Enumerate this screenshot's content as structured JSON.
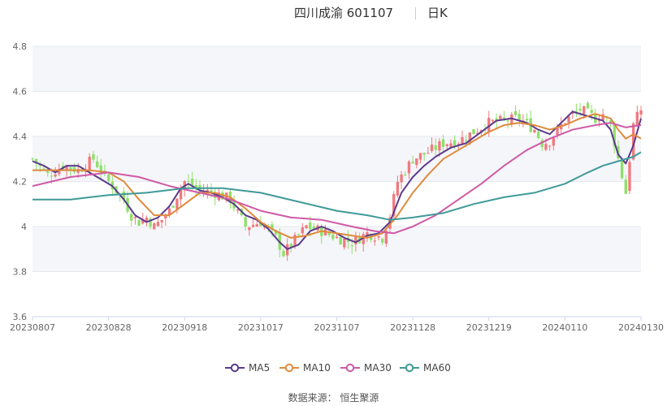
{
  "title": {
    "name": "四川成渝 601107",
    "period": "日K"
  },
  "legend": [
    {
      "name": "MA5",
      "color": "#5b3a8c"
    },
    {
      "name": "MA10",
      "color": "#e08a3c"
    },
    {
      "name": "MA30",
      "color": "#cf5aa6"
    },
    {
      "name": "MA60",
      "color": "#3f9a98"
    }
  ],
  "source": "数据来源： 恒生聚源",
  "colors": {
    "up": "#f07a7f",
    "down": "#8fe06a",
    "plot_band": "#f5f6fa",
    "grid": "#e6e8ef"
  },
  "chart_data": {
    "type": "candlestick",
    "ylim": [
      3.6,
      4.8
    ],
    "yticks": [
      "3.6",
      "3.8",
      "4",
      "4.2",
      "4.4",
      "4.6",
      "4.8"
    ],
    "xticks": [
      "20230807",
      "20230828",
      "20230918",
      "20231017",
      "20231107",
      "20231128",
      "20231219",
      "20240110",
      "20240130"
    ],
    "xtick_index": [
      0,
      20,
      40,
      60,
      80,
      100,
      120,
      140,
      160
    ],
    "n_candles": 161,
    "close_anchors": [
      [
        0,
        4.3
      ],
      [
        4,
        4.23
      ],
      [
        8,
        4.27
      ],
      [
        12,
        4.25
      ],
      [
        16,
        4.3
      ],
      [
        20,
        4.2
      ],
      [
        24,
        4.12
      ],
      [
        26,
        4.05
      ],
      [
        28,
        4.02
      ],
      [
        30,
        4.04
      ],
      [
        32,
        4.0
      ],
      [
        34,
        4.03
      ],
      [
        36,
        4.07
      ],
      [
        38,
        4.14
      ],
      [
        40,
        4.2
      ],
      [
        42,
        4.18
      ],
      [
        44,
        4.16
      ],
      [
        48,
        4.15
      ],
      [
        52,
        4.12
      ],
      [
        56,
        4.0
      ],
      [
        60,
        4.02
      ],
      [
        64,
        3.95
      ],
      [
        66,
        3.88
      ],
      [
        68,
        3.92
      ],
      [
        72,
        4.0
      ],
      [
        76,
        3.98
      ],
      [
        80,
        3.95
      ],
      [
        84,
        3.93
      ],
      [
        88,
        3.97
      ],
      [
        92,
        3.95
      ],
      [
        94,
        4.05
      ],
      [
        96,
        4.2
      ],
      [
        98,
        4.25
      ],
      [
        100,
        4.3
      ],
      [
        104,
        4.33
      ],
      [
        108,
        4.37
      ],
      [
        112,
        4.38
      ],
      [
        116,
        4.42
      ],
      [
        120,
        4.46
      ],
      [
        124,
        4.47
      ],
      [
        128,
        4.48
      ],
      [
        132,
        4.43
      ],
      [
        134,
        4.37
      ],
      [
        136,
        4.38
      ],
      [
        140,
        4.47
      ],
      [
        144,
        4.52
      ],
      [
        148,
        4.48
      ],
      [
        150,
        4.5
      ],
      [
        152,
        4.45
      ],
      [
        154,
        4.3
      ],
      [
        156,
        4.15
      ],
      [
        158,
        4.45
      ],
      [
        160,
        4.52
      ]
    ],
    "series": [
      {
        "name": "MA5",
        "color": "#5b3a8c",
        "points": [
          [
            0,
            4.29
          ],
          [
            3,
            4.27
          ],
          [
            6,
            4.24
          ],
          [
            9,
            4.27
          ],
          [
            12,
            4.27
          ],
          [
            14,
            4.25
          ],
          [
            17,
            4.22
          ],
          [
            19,
            4.2
          ],
          [
            21,
            4.18
          ],
          [
            24,
            4.12
          ],
          [
            27,
            4.05
          ],
          [
            30,
            4.02
          ],
          [
            33,
            4.04
          ],
          [
            36,
            4.09
          ],
          [
            39,
            4.17
          ],
          [
            41,
            4.19
          ],
          [
            44,
            4.16
          ],
          [
            47,
            4.15
          ],
          [
            50,
            4.13
          ],
          [
            53,
            4.1
          ],
          [
            56,
            4.05
          ],
          [
            59,
            4.03
          ],
          [
            62,
            3.99
          ],
          [
            65,
            3.93
          ],
          [
            67,
            3.9
          ],
          [
            70,
            3.92
          ],
          [
            73,
            3.98
          ],
          [
            76,
            4.0
          ],
          [
            79,
            3.98
          ],
          [
            82,
            3.95
          ],
          [
            85,
            3.93
          ],
          [
            88,
            3.96
          ],
          [
            91,
            3.97
          ],
          [
            94,
            4.02
          ],
          [
            97,
            4.15
          ],
          [
            100,
            4.22
          ],
          [
            103,
            4.27
          ],
          [
            106,
            4.31
          ],
          [
            110,
            4.35
          ],
          [
            114,
            4.37
          ],
          [
            118,
            4.42
          ],
          [
            122,
            4.47
          ],
          [
            126,
            4.48
          ],
          [
            130,
            4.46
          ],
          [
            133,
            4.43
          ],
          [
            136,
            4.41
          ],
          [
            139,
            4.46
          ],
          [
            142,
            4.51
          ],
          [
            146,
            4.49
          ],
          [
            150,
            4.47
          ],
          [
            152,
            4.43
          ],
          [
            154,
            4.32
          ],
          [
            156,
            4.28
          ],
          [
            158,
            4.36
          ],
          [
            160,
            4.48
          ]
        ]
      },
      {
        "name": "MA10",
        "color": "#e08a3c",
        "points": [
          [
            0,
            4.25
          ],
          [
            5,
            4.25
          ],
          [
            10,
            4.25
          ],
          [
            15,
            4.25
          ],
          [
            20,
            4.24
          ],
          [
            24,
            4.2
          ],
          [
            28,
            4.12
          ],
          [
            32,
            4.05
          ],
          [
            36,
            4.05
          ],
          [
            40,
            4.1
          ],
          [
            44,
            4.15
          ],
          [
            48,
            4.15
          ],
          [
            52,
            4.13
          ],
          [
            56,
            4.08
          ],
          [
            60,
            4.02
          ],
          [
            64,
            3.98
          ],
          [
            68,
            3.95
          ],
          [
            72,
            3.96
          ],
          [
            76,
            3.98
          ],
          [
            80,
            3.97
          ],
          [
            84,
            3.96
          ],
          [
            88,
            3.95
          ],
          [
            92,
            3.97
          ],
          [
            96,
            4.05
          ],
          [
            100,
            4.15
          ],
          [
            104,
            4.23
          ],
          [
            108,
            4.3
          ],
          [
            112,
            4.34
          ],
          [
            116,
            4.38
          ],
          [
            120,
            4.42
          ],
          [
            124,
            4.45
          ],
          [
            128,
            4.46
          ],
          [
            132,
            4.45
          ],
          [
            136,
            4.43
          ],
          [
            140,
            4.45
          ],
          [
            144,
            4.48
          ],
          [
            148,
            4.5
          ],
          [
            152,
            4.48
          ],
          [
            154,
            4.43
          ],
          [
            156,
            4.39
          ],
          [
            158,
            4.41
          ],
          [
            160,
            4.39
          ]
        ]
      },
      {
        "name": "MA30",
        "color": "#cf5aa6",
        "points": [
          [
            0,
            4.18
          ],
          [
            10,
            4.22
          ],
          [
            20,
            4.24
          ],
          [
            28,
            4.22
          ],
          [
            36,
            4.18
          ],
          [
            44,
            4.15
          ],
          [
            52,
            4.12
          ],
          [
            60,
            4.07
          ],
          [
            68,
            4.04
          ],
          [
            76,
            4.03
          ],
          [
            84,
            4.0
          ],
          [
            90,
            3.98
          ],
          [
            95,
            3.97
          ],
          [
            100,
            4.0
          ],
          [
            106,
            4.05
          ],
          [
            112,
            4.12
          ],
          [
            118,
            4.19
          ],
          [
            124,
            4.27
          ],
          [
            130,
            4.34
          ],
          [
            136,
            4.39
          ],
          [
            142,
            4.43
          ],
          [
            148,
            4.45
          ],
          [
            152,
            4.46
          ],
          [
            156,
            4.44
          ],
          [
            160,
            4.45
          ]
        ]
      },
      {
        "name": "MA60",
        "color": "#3f9a98",
        "points": [
          [
            0,
            4.12
          ],
          [
            10,
            4.12
          ],
          [
            20,
            4.14
          ],
          [
            30,
            4.15
          ],
          [
            40,
            4.17
          ],
          [
            50,
            4.17
          ],
          [
            60,
            4.15
          ],
          [
            70,
            4.11
          ],
          [
            80,
            4.07
          ],
          [
            88,
            4.05
          ],
          [
            94,
            4.03
          ],
          [
            100,
            4.04
          ],
          [
            108,
            4.06
          ],
          [
            116,
            4.1
          ],
          [
            124,
            4.13
          ],
          [
            132,
            4.15
          ],
          [
            140,
            4.19
          ],
          [
            146,
            4.24
          ],
          [
            150,
            4.27
          ],
          [
            154,
            4.29
          ],
          [
            158,
            4.31
          ],
          [
            160,
            4.33
          ]
        ]
      }
    ]
  }
}
